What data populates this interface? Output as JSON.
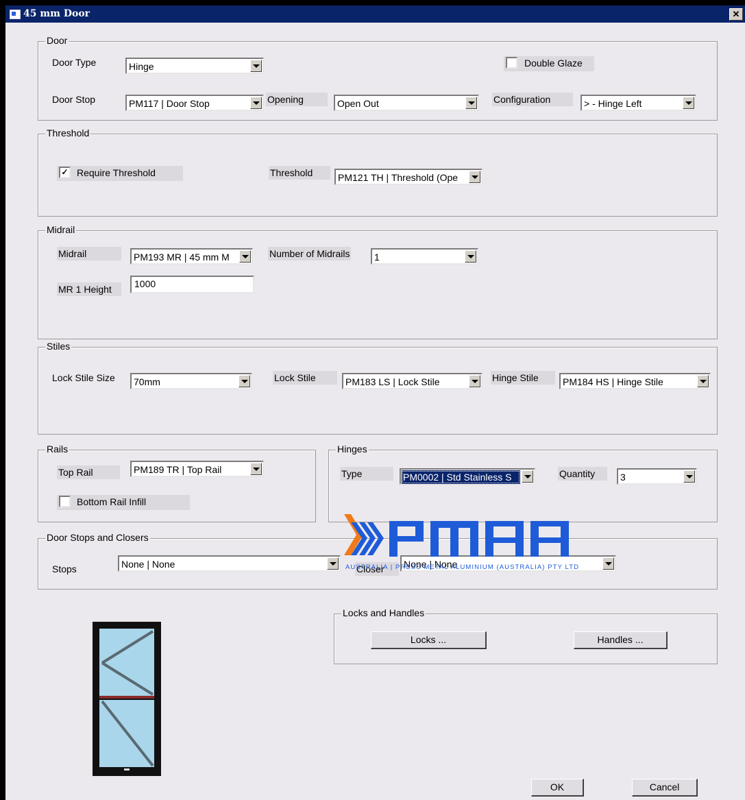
{
  "window": {
    "title": "45 mm Door",
    "close_glyph": "✕"
  },
  "door_group": {
    "legend": "Door",
    "door_type_label": "Door Type",
    "door_type_value": "Hinge",
    "double_glaze_label": "Double Glaze",
    "double_glaze_checked": false,
    "door_stop_label": "Door Stop",
    "door_stop_value": "PM117 | Door Stop",
    "opening_label": "Opening",
    "opening_value": "Open Out",
    "configuration_label": "Configuration",
    "configuration_value": "> - Hinge Left"
  },
  "threshold_group": {
    "legend": "Threshold",
    "require_label": "Require Threshold",
    "require_checked": true,
    "threshold_label": "Threshold",
    "threshold_value": "PM121 TH | Threshold (Ope"
  },
  "midrail_group": {
    "legend": "Midrail",
    "midrail_label": "Midrail",
    "midrail_value": "PM193 MR | 45 mm M",
    "number_label": "Number of Midrails",
    "number_value": "1",
    "height_label": "MR 1 Height",
    "height_value": "1000"
  },
  "stiles_group": {
    "legend": "Stiles",
    "lock_size_label": "Lock Stile Size",
    "lock_size_value": "70mm",
    "lock_stile_label": "Lock Stile",
    "lock_stile_value": "PM183 LS | Lock Stile",
    "hinge_stile_label": "Hinge Stile",
    "hinge_stile_value": "PM184 HS | Hinge Stile"
  },
  "rails_group": {
    "legend": "Rails",
    "top_rail_label": "Top Rail",
    "top_rail_value": "PM189 TR | Top Rail",
    "bottom_infill_label": "Bottom Rail Infill",
    "bottom_infill_checked": false
  },
  "hinges_group": {
    "legend": "Hinges",
    "type_label": "Type",
    "type_value": "PM0002 | Std Stainless S",
    "quantity_label": "Quantity",
    "quantity_value": "3"
  },
  "stops_group": {
    "legend": "Door Stops and Closers",
    "stops_label": "Stops",
    "stops_value": "None | None",
    "closer_label": "Closer",
    "closer_value": "None | None"
  },
  "locks_group": {
    "legend": "Locks and Handles",
    "locks_button": "Locks ...",
    "handles_button": "Handles ..."
  },
  "logo": {
    "brand": "PMAA",
    "tagline": "AUSTRALIA | PRESS METAL ALUMINIUM (AUSTRALIA) PTY LTD",
    "colors": {
      "blue": "#1e5bd8",
      "orange": "#f07a1a"
    }
  },
  "footer": {
    "ok_button": "OK",
    "cancel_button": "Cancel"
  },
  "colors": {
    "titlebar": "#0a246a",
    "dialog_bg": "#ece9ee",
    "selection": "#0a246a"
  }
}
